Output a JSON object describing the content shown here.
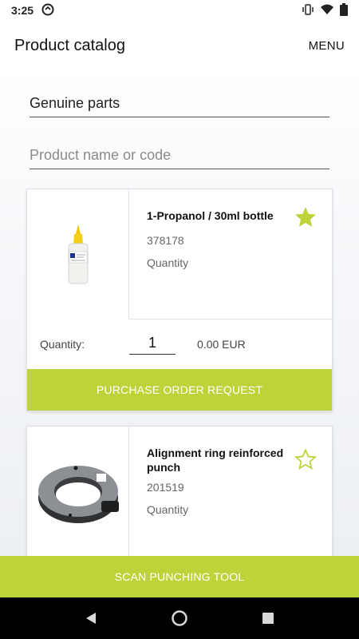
{
  "status_bar": {
    "time": "3:25",
    "icons": [
      "sync-circle-icon",
      "vibrate-icon",
      "wifi-icon",
      "battery-icon"
    ]
  },
  "app_bar": {
    "title": "Product catalog",
    "menu_label": "MENU"
  },
  "filters": {
    "category_value": "Genuine parts",
    "search_placeholder": "Product name or code"
  },
  "products": [
    {
      "name": "1-Propanol / 30ml bottle",
      "code": "378178",
      "quantity_label": "Quantity",
      "favorite": true,
      "image": "bottle-image",
      "row_quantity_label": "Quantity:",
      "quantity_value": "1",
      "price": "0.00 EUR",
      "action_label": "PURCHASE ORDER REQUEST"
    },
    {
      "name": "Alignment ring reinforced punch",
      "code": "201519",
      "quantity_label": "Quantity",
      "favorite": false,
      "image": "alignment-ring-image"
    }
  ],
  "bottom_action": {
    "label": "SCAN PUNCHING TOOL"
  },
  "colors": {
    "accent": "#bed23a",
    "background": "#e9ecf2"
  },
  "nav": [
    "back-icon",
    "home-icon",
    "recents-icon"
  ]
}
